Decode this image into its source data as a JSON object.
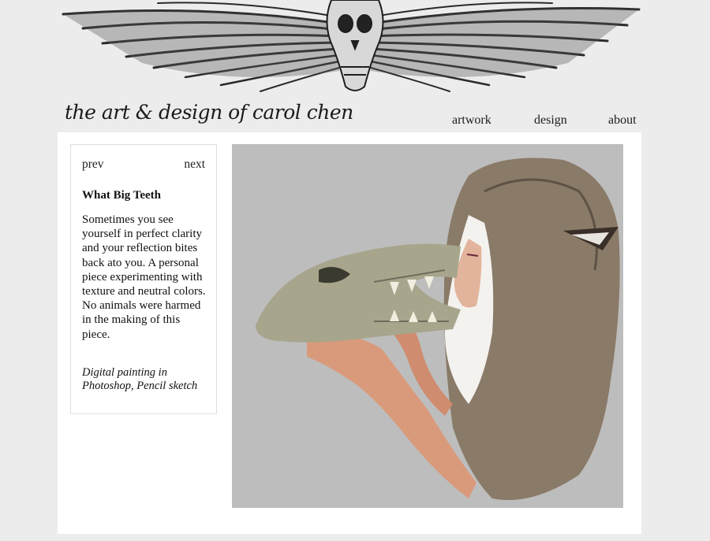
{
  "site": {
    "title": "the art & design of carol chen"
  },
  "nav": {
    "artwork": "artwork",
    "design": "design",
    "about": "about"
  },
  "pager": {
    "prev": "prev",
    "next": "next"
  },
  "piece": {
    "title": "What Big Teeth",
    "description": "Sometimes you see yourself in perfect clarity and your reflection bites back ato you. A personal piece experimenting with texture and neutral colors. No animals were harmed in the making of this piece.",
    "medium": "Digital painting in Photoshop, Pencil sketch"
  },
  "images": {
    "banner": "winged-skull-banner",
    "artwork": "girl-with-wolf-skull-painting"
  },
  "colors": {
    "page_bg": "#ececec",
    "panel_bg": "#ffffff",
    "artwork_bg": "#bdbdbd",
    "fur": "#8a7a68",
    "skin": "#d99a7c",
    "skull": "#a7a58c"
  }
}
